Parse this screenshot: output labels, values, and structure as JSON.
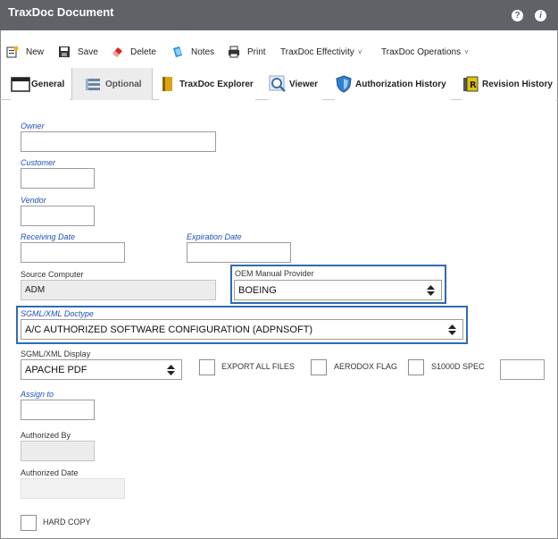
{
  "window": {
    "title": "TraxDoc Document",
    "help_glyph": "?",
    "info_glyph": "i"
  },
  "toolbar": {
    "new_label": "New",
    "save_label": "Save",
    "delete_label": "Delete",
    "notes_label": "Notes",
    "print_label": "Print",
    "effectivity_label": "TraxDoc Effectivity",
    "operations_label": "TraxDoc Operations",
    "caret": "˅"
  },
  "tabs": [
    {
      "label": "General",
      "icon": "window-icon"
    },
    {
      "label": "Optional",
      "icon": "stack-icon"
    },
    {
      "label": "TraxDoc Explorer",
      "icon": "book-icon"
    },
    {
      "label": "Viewer",
      "icon": "magnifier-icon"
    },
    {
      "label": "Authorization History",
      "icon": "shield-icon"
    },
    {
      "label": "Revision History",
      "icon": "revision-icon"
    }
  ],
  "form": {
    "owner_label": "Owner",
    "owner_value": "",
    "customer_label": "Customer",
    "customer_value": "",
    "vendor_label": "Vendor",
    "vendor_value": "",
    "receiving_date_label": "Receiving Date",
    "receiving_date_value": "",
    "expiration_date_label": "Expiration Date",
    "expiration_date_value": "",
    "source_computer_label": "Source Computer",
    "source_computer_value": "ADM",
    "oem_provider_label": "OEM Manual Provider",
    "oem_provider_value": "BOEING",
    "sgml_doctype_label": "SGML/XML Doctype",
    "sgml_doctype_value": "A/C AUTHORIZED SOFTWARE CONFIGURATION (ADPNSOFT)",
    "sgml_display_label": "SGML/XML Display",
    "sgml_display_value": "APACHE PDF",
    "export_all_label": "EXPORT ALL FILES",
    "aerodox_label": "AERODOX FLAG",
    "s1000d_label": "S1000D SPEC",
    "s1000d_value": "",
    "assign_to_label": "Assign to",
    "assign_to_value": "",
    "authorized_by_label": "Authorized By",
    "authorized_by_value": "",
    "authorized_date_label": "Authorized Date",
    "authorized_date_value": "",
    "hard_copy_label": "HARD COPY"
  },
  "colors": {
    "titlebar": "#616268",
    "highlight": "#2f6bb3",
    "link_label": "#1f4fbf"
  }
}
